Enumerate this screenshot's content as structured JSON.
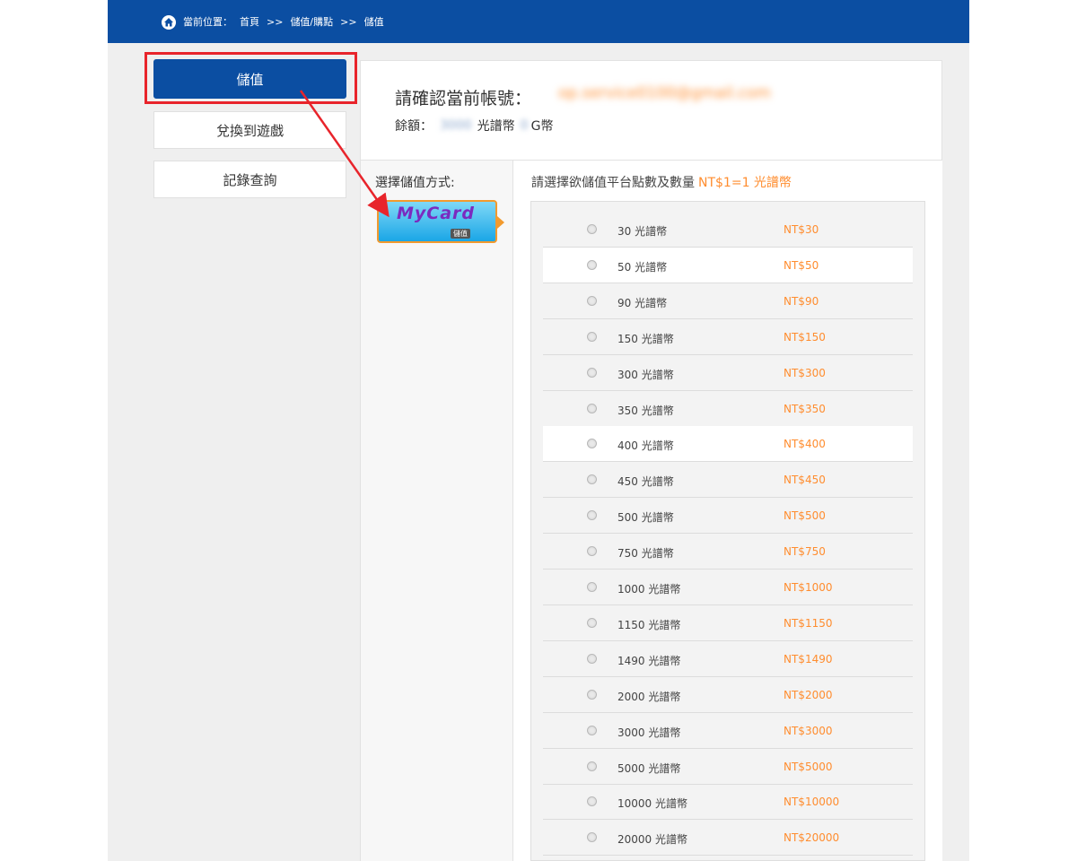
{
  "breadcrumb": {
    "icon": "home-icon",
    "label": "當前位置：",
    "home": "首頁",
    "sep1": ">>",
    "section": "儲值/購點",
    "sep2": ">>",
    "current": "儲值"
  },
  "sidebar": {
    "items": [
      {
        "label": "儲值",
        "active": true
      },
      {
        "label": "兌換到遊戲",
        "active": false
      },
      {
        "label": "記錄查詢",
        "active": false
      }
    ]
  },
  "account": {
    "confirm_label": "請確認當前帳號：",
    "email": "op.service0100@gmail.com",
    "balance_label": "餘額：",
    "balance_value": "3000",
    "balance_unit": "光譜幣",
    "gcoin_value": "0",
    "gcoin_unit": "G幣"
  },
  "payment": {
    "title": "選擇儲值方式:",
    "method_logo": "MyCard",
    "method_sub": "儲值"
  },
  "pricing": {
    "header": "請選擇欲儲值平台點數及數量",
    "rate": "NT$1=1 光譜幣",
    "options": [
      {
        "points": "30 光譜幣",
        "price": "NT$30"
      },
      {
        "points": "50 光譜幣",
        "price": "NT$50"
      },
      {
        "points": "90 光譜幣",
        "price": "NT$90"
      },
      {
        "points": "150 光譜幣",
        "price": "NT$150"
      },
      {
        "points": "300 光譜幣",
        "price": "NT$300"
      },
      {
        "points": "350 光譜幣",
        "price": "NT$350"
      },
      {
        "points": "400 光譜幣",
        "price": "NT$400"
      },
      {
        "points": "450 光譜幣",
        "price": "NT$450"
      },
      {
        "points": "500 光譜幣",
        "price": "NT$500"
      },
      {
        "points": "750 光譜幣",
        "price": "NT$750"
      },
      {
        "points": "1000 光譜幣",
        "price": "NT$1000"
      },
      {
        "points": "1150 光譜幣",
        "price": "NT$1150"
      },
      {
        "points": "1490 光譜幣",
        "price": "NT$1490"
      },
      {
        "points": "2000 光譜幣",
        "price": "NT$2000"
      },
      {
        "points": "3000 光譜幣",
        "price": "NT$3000"
      },
      {
        "points": "5000 光譜幣",
        "price": "NT$5000"
      },
      {
        "points": "10000 光譜幣",
        "price": "NT$10000"
      },
      {
        "points": "20000 光譜幣",
        "price": "NT$20000"
      }
    ]
  },
  "colors": {
    "brand_blue": "#0b4ea2",
    "accent_orange": "#ff8d2f",
    "annotation_red": "#e8242b"
  }
}
